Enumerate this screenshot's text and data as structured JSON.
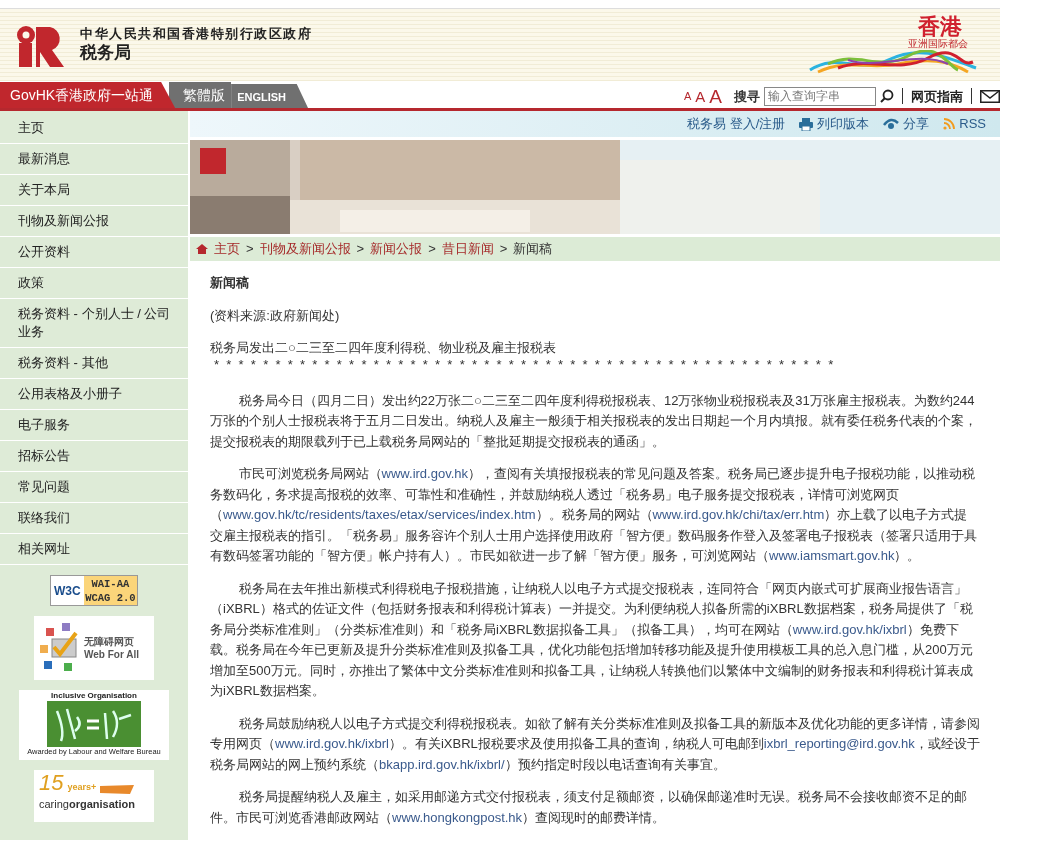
{
  "header": {
    "department_line": "中华人民共和国香港特别行政区政府",
    "department": "税务局",
    "brand_title": "香港",
    "brand_tagline": "亚洲国际都会"
  },
  "language_tabs": [
    {
      "label": "GovHK香港政府一站通",
      "kind": "govhk"
    },
    {
      "label": "繁體版",
      "kind": "lang"
    },
    {
      "label": "ENGLISH",
      "kind": "lang"
    }
  ],
  "font_sizes": [
    "A",
    "A",
    "A"
  ],
  "search": {
    "label": "搜寻",
    "placeholder": "输入查询字串"
  },
  "guide_link": "网页指南",
  "toolbar": [
    {
      "label": "税务易 登入/注册",
      "kind": "login"
    },
    {
      "label": "列印版本",
      "kind": "print"
    },
    {
      "label": "分享",
      "kind": "share"
    },
    {
      "label": "RSS",
      "kind": "rss"
    }
  ],
  "sidebar": {
    "items": [
      "主页",
      "最新消息",
      "关于本局",
      "刊物及新闻公报",
      "公开资料",
      "政策",
      "税务资料 - 个别人士 / 公司业务",
      "税务资料 - 其他",
      "公用表格及小册子",
      "电子服务",
      "招标公告",
      "常见问题",
      "联络我们",
      "相关网址"
    ],
    "badges": [
      {
        "kind": "w3c",
        "logo": "W3C",
        "line_1": "WAI-AA",
        "line_2": "WCAG 2.0"
      },
      {
        "kind": "webforall",
        "line_1": "无障碍网页",
        "line_2": "Web For All"
      },
      {
        "kind": "inclusive",
        "line_1": "Inclusive Organisation",
        "line_2": "Awarded by Labour and Welfare Bureau"
      },
      {
        "kind": "caring",
        "line_1": "15",
        "line_2": "years+",
        "line_3": "caring**organisation**"
      }
    ]
  },
  "breadcrumb": [
    {
      "label": "主页",
      "current": false
    },
    {
      "separator": ">",
      "label": "刊物及新闻公报",
      "current": false
    },
    {
      "separator": ">",
      "label": "新闻公报",
      "current": false
    },
    {
      "separator": ">",
      "label": "昔日新闻",
      "current": false
    },
    {
      "separator": ">",
      "label": "新闻稿",
      "current": true
    }
  ],
  "article": {
    "heading": "新闻稿",
    "source": "(资料来源:政府新闻处)",
    "title": "税务局发出二○二三至二四年度利得税、物业税及雇主报税表",
    "stars": "*  *  *  *  *  *  *  *  *  *  *  *  *  *  *  *  *  *  *  *  *  *  *  *  *  *  *  *  *  *  *  *  *  *  *  *  *  *  *  *  *  *  *  *  *  *  *  *  *  *  *",
    "paragraphs": [
      [
        {
          "text": "税务局今日（四月二日）发出约22万张二○二三至二四年度利得税报税表、12万张物业税报税表及31万张雇主报税表。为数约244万张的个别人士报税表将于五月二日发出。纳税人及雇主一般须于相关报税表的发出日期起一个月内填报。就有委任税务代表的个案，提交报税表的期限载列于已上载税务局网站的「整批延期提交报税表的通函」。"
        }
      ],
      [
        {
          "text": "市民可浏览税务局网站（"
        },
        {
          "link": "www.ird.gov.hk"
        },
        {
          "text": "），查阅有关填报报税表的常见问题及答案。税务局已逐步提升电子报税功能，以推动税务数码化，务求提高报税的效率、可靠性和准确性，并鼓励纳税人透过「税务易」电子服务提交报税表，详情可浏览网页（"
        },
        {
          "link": "www.gov.hk/tc/residents/taxes/etax/services/index.htm"
        },
        {
          "text": "）。税务局的网站（"
        },
        {
          "link": "www.ird.gov.hk/chi/tax/err.htm"
        },
        {
          "text": "）亦上载了以电子方式提交雇主报税表的指引。「税务易」服务容许个别人士用户选择使用政府「智方便」数码服务作登入及签署电子报税表（签署只适用于具有数码签署功能的「智方便」帐户持有人）。市民如欲进一步了解「智方便」服务，可浏览网站（"
        },
        {
          "link": "www.iamsmart.gov.hk"
        },
        {
          "text": "）。"
        }
      ],
      [
        {
          "text": "税务局在去年推出新模式利得税电子报税措施，让纳税人以电子方式提交报税表，连同符合「网页内嵌式可扩展商业报告语言」（iXBRL）格式的佐证文件（包括财务报表和利得税计算表）一并提交。为利便纳税人拟备所需的iXBRL数据档案，税务局提供了「税务局分类标准准则」（分类标准准则）和「税务局iXBRL数据拟备工具」（拟备工具），均可在网站（"
        },
        {
          "link": "www.ird.gov.hk/ixbrl"
        },
        {
          "text": "）免费下载。税务局在今年已更新及提升分类标准准则及拟备工具，优化功能包括增加转移功能及提升使用模板工具的总入息门槛，从200万元增加至500万元。同时，亦推出了繁体中文分类标准准则和拟备工具，让纳税人转换他们以繁体中文编制的财务报表和利得税计算表成为iXBRL数据档案。"
        }
      ],
      [
        {
          "text": "税务局鼓励纳税人以电子方式提交利得税报税表。如欲了解有关分类标准准则及拟备工具的新版本及优化功能的更多详情，请参阅专用网页（"
        },
        {
          "link": "www.ird.gov.hk/ixbrl"
        },
        {
          "text": "）。有关iXBRL报税要求及使用拟备工具的查询，纳税人可电邮到"
        },
        {
          "link": "ixbrl_reporting@ird.gov.hk"
        },
        {
          "text": "，或经设于税务局网站的网上预约系统（"
        },
        {
          "link": "bkapp.ird.gov.hk/ixbrl/"
        },
        {
          "text": "）预约指定时段以电话查询有关事宜。"
        }
      ],
      [
        {
          "text": "税务局提醒纳税人及雇主，如采用邮递方式交付报税表，须支付足额邮资，以确保邮递准时无误。税务局不会接收邮资不足的邮件。市民可浏览香港邮政网站（"
        },
        {
          "link": "www.hongkongpost.hk"
        },
        {
          "text": "）查阅现时的邮费详情。"
        }
      ]
    ]
  }
}
